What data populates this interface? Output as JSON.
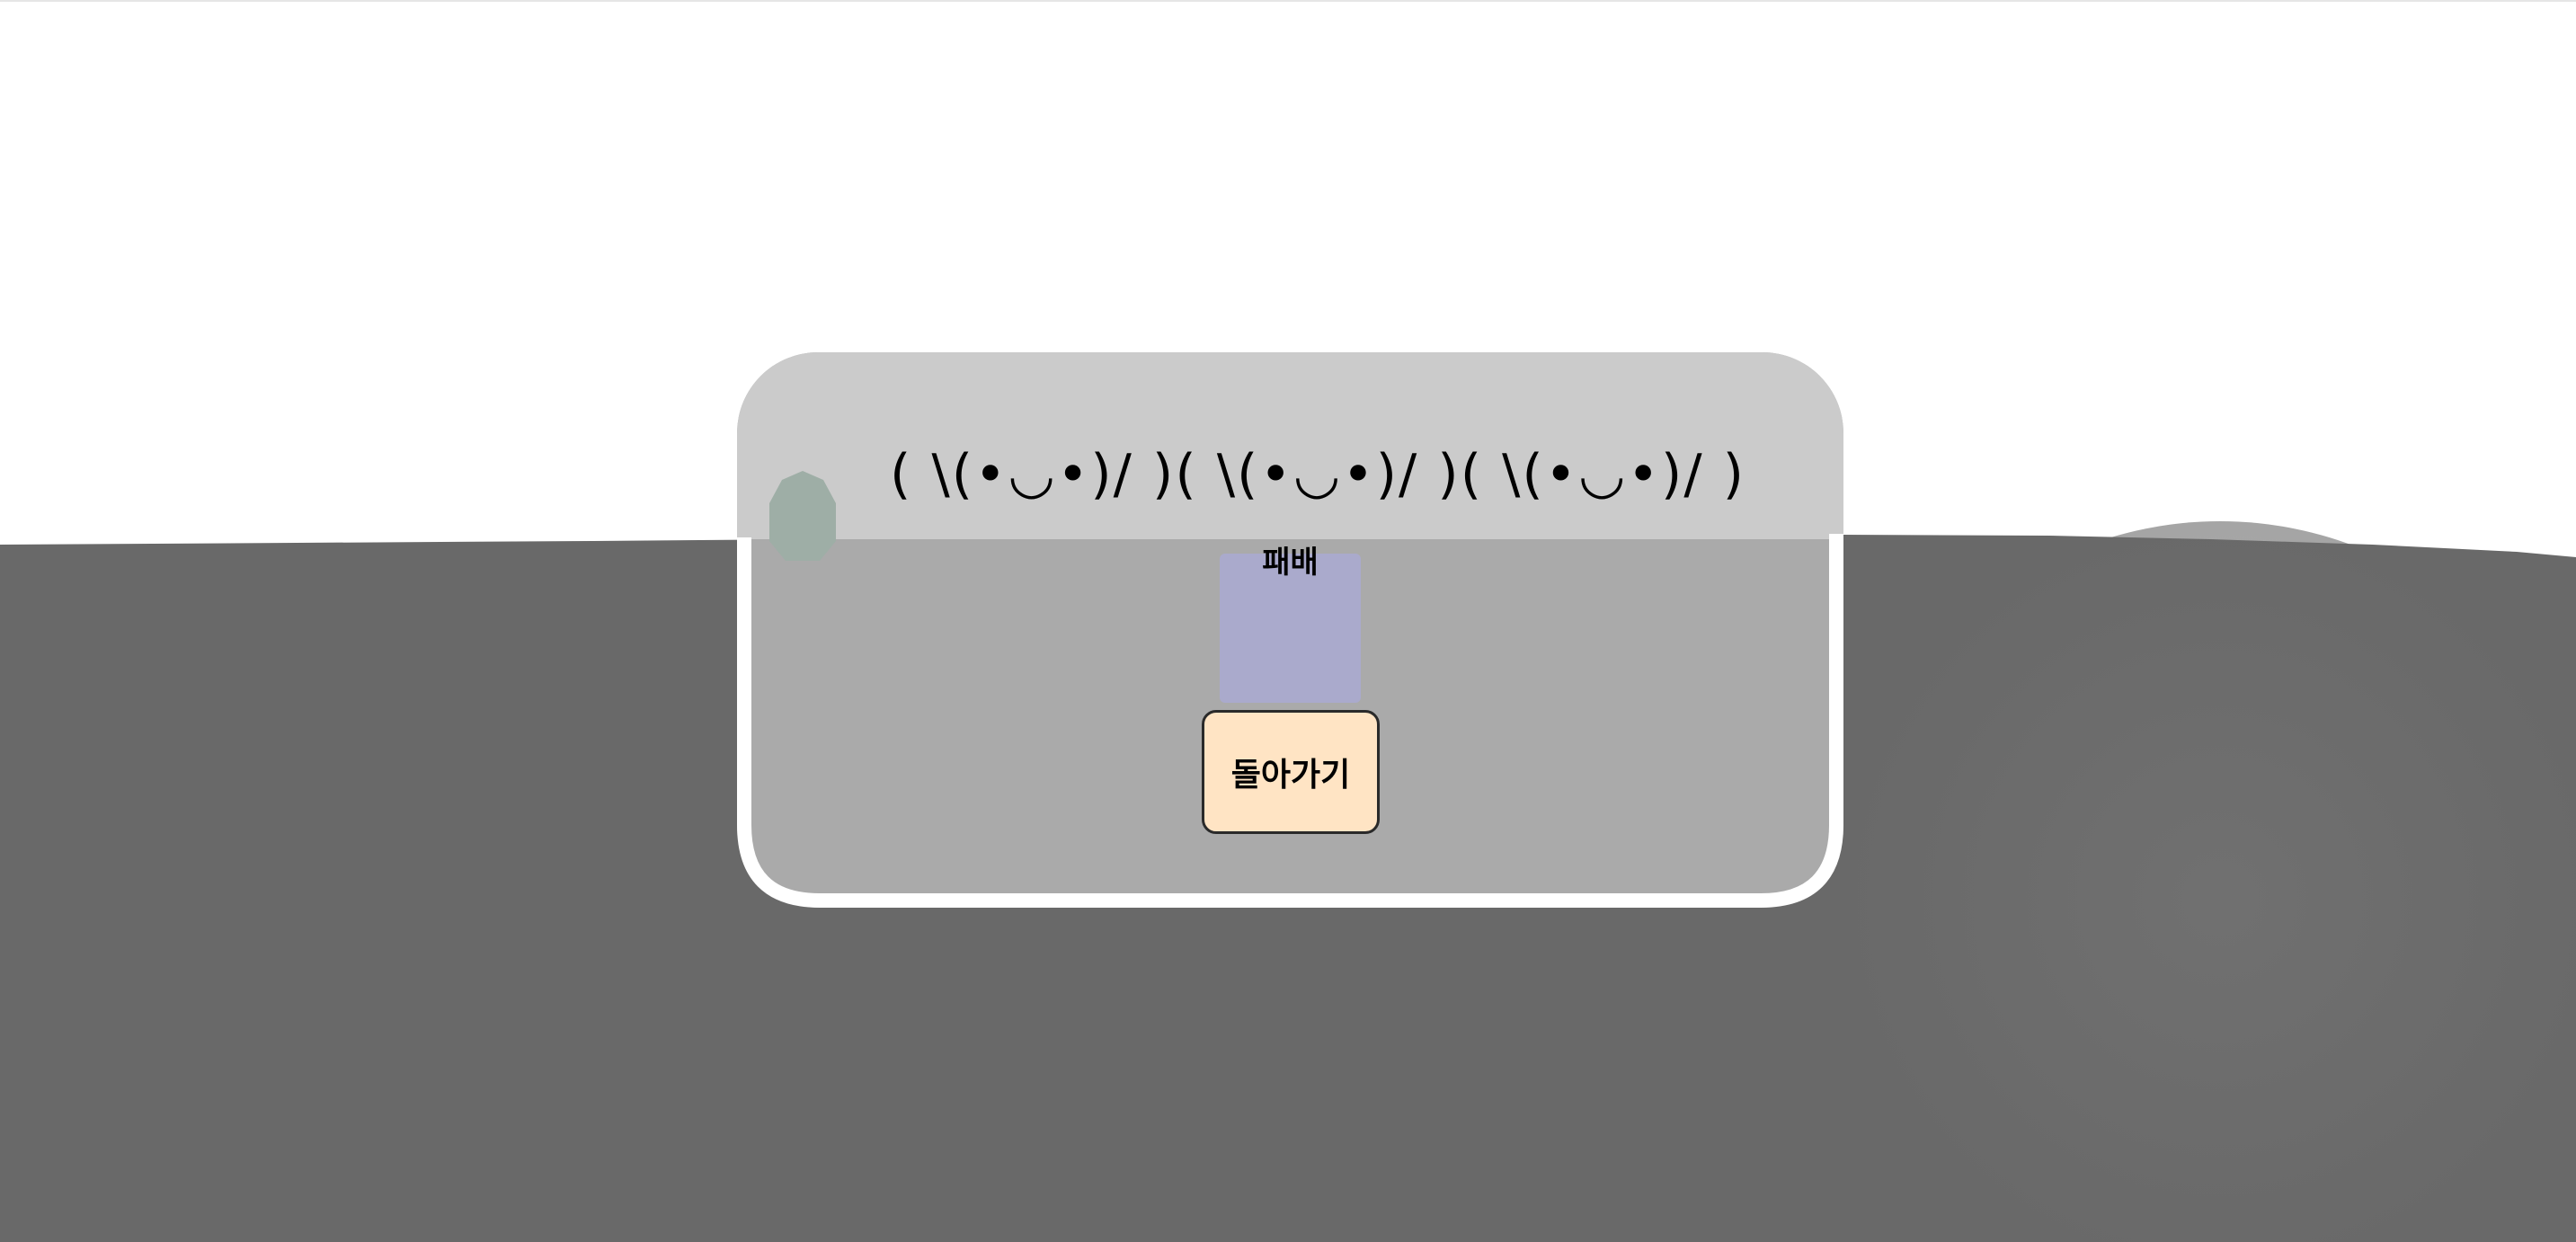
{
  "result": {
    "kaomoji": [
      "( \\(•◡•)/ )",
      "( \\(•◡•)/ )",
      "( \\(•◡•)/ )"
    ],
    "status_label": "패배",
    "back_button_label": "돌아가기"
  },
  "colors": {
    "ground": "#696969",
    "dialog_top": "#cbcbcb",
    "dialog_body": "#aaaaaa",
    "dialog_border": "#ffffff",
    "status_panel": "#aaaacc",
    "back_button": "#ffe4c4",
    "home_badge": "#9eaea6"
  },
  "icons": {
    "badge": "home-badge-icon"
  }
}
